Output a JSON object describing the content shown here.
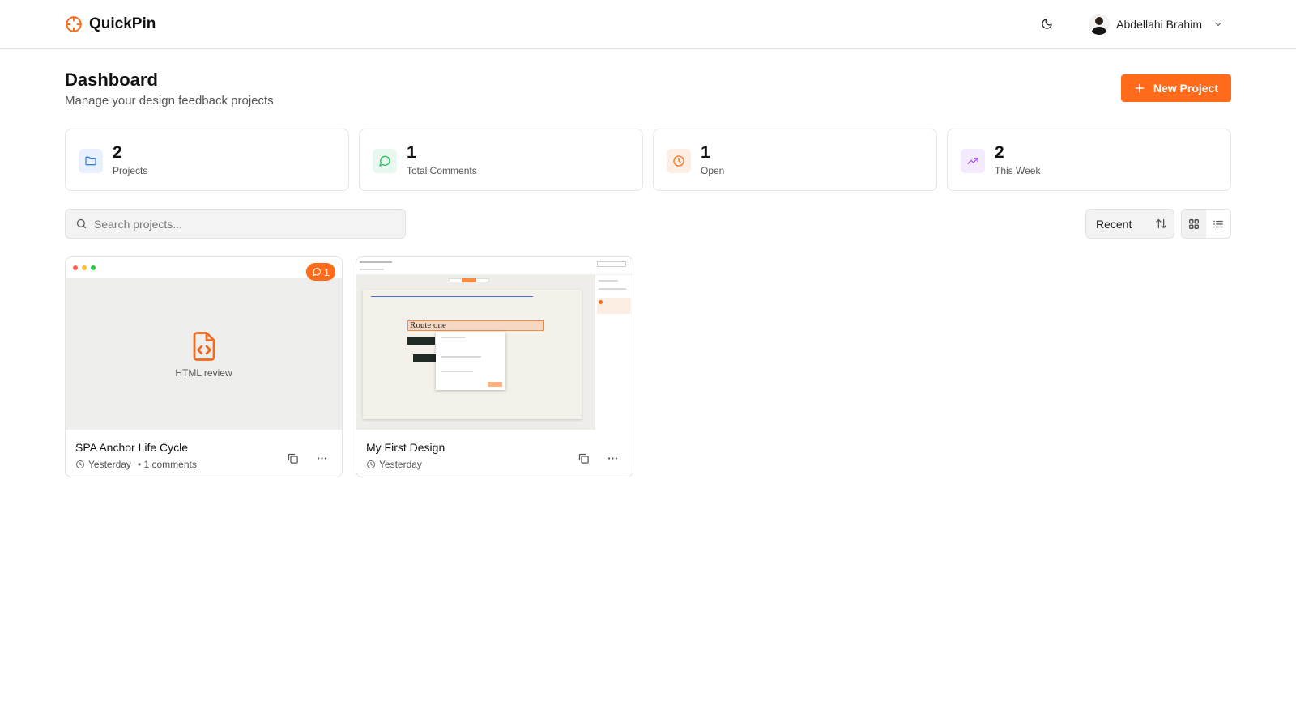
{
  "app": {
    "name": "QuickPin",
    "brand_color": "#ff6b1a"
  },
  "header": {
    "user_name": "Abdellahi Brahim",
    "theme_icon": "moon-icon",
    "user_menu_icon": "chevron-down-icon"
  },
  "page": {
    "title": "Dashboard",
    "subtitle": "Manage your design feedback projects",
    "new_project_label": "New Project"
  },
  "stats": [
    {
      "value": "2",
      "label": "Projects",
      "icon": "folder-icon",
      "color": "#3b82f6",
      "bg": "#eaf1fe"
    },
    {
      "value": "1",
      "label": "Total Comments",
      "icon": "message-circle-icon",
      "color": "#22c55e",
      "bg": "#e8f8ee"
    },
    {
      "value": "1",
      "label": "Open",
      "icon": "clock-icon",
      "color": "#f97316",
      "bg": "#fdeee3"
    },
    {
      "value": "2",
      "label": "This Week",
      "icon": "trending-up-icon",
      "color": "#a855f7",
      "bg": "#f4ebfe"
    }
  ],
  "toolbar": {
    "search_placeholder": "Search projects...",
    "sort_value": "Recent"
  },
  "projects": [
    {
      "title": "SPA Anchor Life Cycle",
      "time": "Yesterday",
      "comments": "• 1 comments",
      "badge": "1",
      "thumb_caption": "HTML review"
    },
    {
      "title": "My First Design",
      "time": "Yesterday",
      "thumb_heading": "Route one"
    }
  ]
}
